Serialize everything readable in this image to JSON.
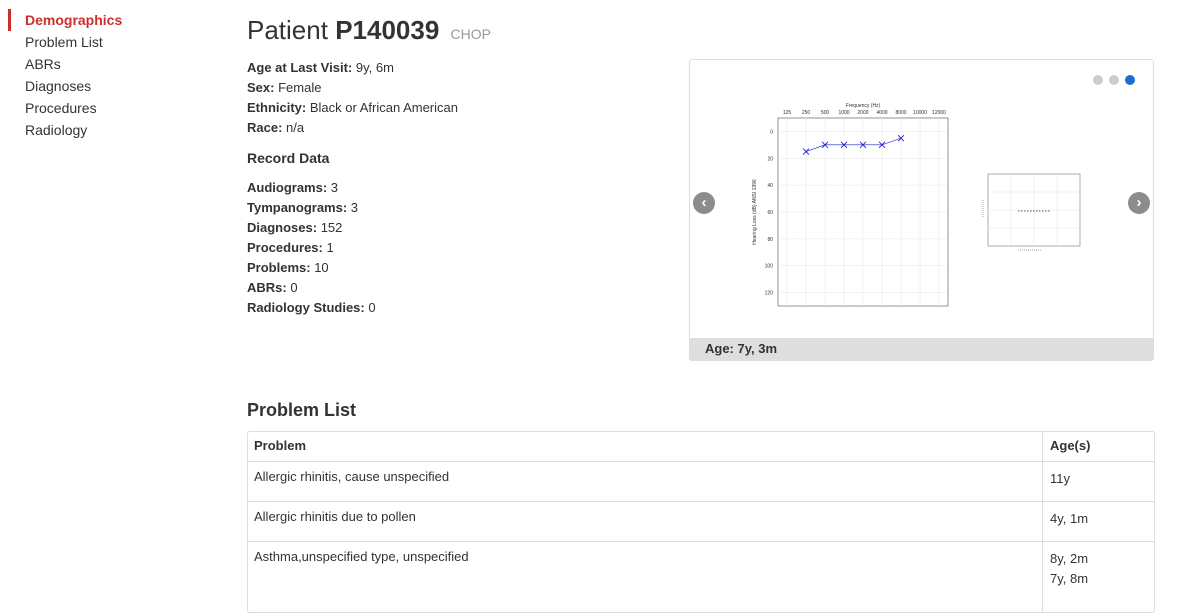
{
  "sidebar": {
    "items": [
      {
        "label": "Demographics",
        "active": true
      },
      {
        "label": "Problem List"
      },
      {
        "label": "ABRs"
      },
      {
        "label": "Diagnoses"
      },
      {
        "label": "Procedures"
      },
      {
        "label": "Radiology"
      }
    ]
  },
  "header": {
    "prefix": "Patient",
    "patient_id": "P140039",
    "site": "CHOP"
  },
  "demographics": [
    {
      "label": "Age at Last Visit:",
      "value": "9y, 6m"
    },
    {
      "label": "Sex:",
      "value": "Female"
    },
    {
      "label": "Ethnicity:",
      "value": "Black or African American"
    },
    {
      "label": "Race:",
      "value": "n/a"
    }
  ],
  "record_data": {
    "title": "Record Data",
    "items": [
      {
        "label": "Audiograms:",
        "value": "3"
      },
      {
        "label": "Tympanograms:",
        "value": "3"
      },
      {
        "label": "Diagnoses:",
        "value": "152"
      },
      {
        "label": "Procedures:",
        "value": "1"
      },
      {
        "label": "Problems:",
        "value": "10"
      },
      {
        "label": "ABRs:",
        "value": "0"
      },
      {
        "label": "Radiology Studies:",
        "value": "0"
      }
    ]
  },
  "carousel": {
    "caption": "Age: 7y, 3m",
    "prev_icon": "chevron-left-icon",
    "next_icon": "chevron-right-icon",
    "slide_count": 3,
    "active_index": 2,
    "prev_glyph": "‹",
    "next_glyph": "›"
  },
  "chart_data": {
    "type": "scatter",
    "title": "Frequency (Hz)",
    "ylabel": "Hearing Loss (dB) ANSI 1996",
    "x_ticks": [
      "125",
      "250",
      "500",
      "1000",
      "2000",
      "4000",
      "8000",
      "10000",
      "12000"
    ],
    "y_ticks": [
      "0",
      "20",
      "40",
      "60",
      "80",
      "100",
      "120"
    ],
    "ylim": [
      -10,
      130
    ],
    "y_inverted": true,
    "series": [
      {
        "marker": "x",
        "color": "#1f1fd6",
        "x": [
          "250",
          "500",
          "1000",
          "2000",
          "4000",
          "8000"
        ],
        "y": [
          15,
          10,
          10,
          10,
          10,
          5
        ]
      }
    ]
  },
  "problem_list": {
    "title": "Problem List",
    "columns": [
      "Problem",
      "Age(s)"
    ],
    "rows": [
      {
        "problem": "Allergic rhinitis, cause unspecified",
        "ages": [
          "11y"
        ]
      },
      {
        "problem": "Allergic rhinitis due to pollen",
        "ages": [
          "4y, 1m"
        ]
      },
      {
        "problem": "Asthma,unspecified type, unspecified",
        "ages": [
          "8y, 2m",
          "7y, 8m"
        ]
      }
    ]
  }
}
